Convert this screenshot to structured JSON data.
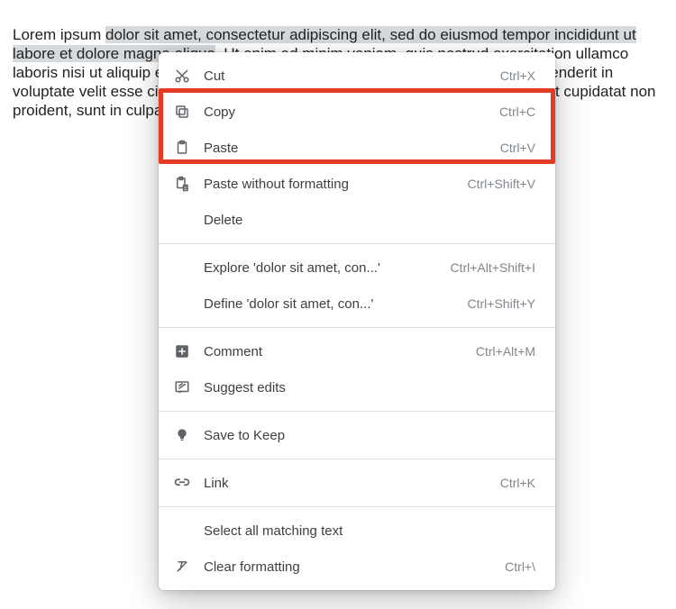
{
  "paragraph": {
    "before_sel": "Lorem ipsum ",
    "selection": "dolor sit amet, consectetur adipiscing elit, sed do eiusmod tempor incididunt ut labore et dolore magna aliqua",
    "after_sel": ". Ut enim ad minim veniam, quis nostrud exercitation ullamco laboris nisi ut aliquip ex ea commodo consequat. Duis aute irure dolor in reprehenderit in voluptate velit esse cillum dolore eu fugiat nulla pariatur. Excepteur sint occaecat cupidatat non proident, sunt in culpa qui officia."
  },
  "menu": {
    "cut": {
      "label": "Cut",
      "shortcut": "Ctrl+X"
    },
    "copy": {
      "label": "Copy",
      "shortcut": "Ctrl+C"
    },
    "paste": {
      "label": "Paste",
      "shortcut": "Ctrl+V"
    },
    "paste_plain": {
      "label": "Paste without formatting",
      "shortcut": "Ctrl+Shift+V"
    },
    "delete": {
      "label": "Delete",
      "shortcut": ""
    },
    "explore": {
      "label": "Explore 'dolor sit amet, con...'",
      "shortcut": "Ctrl+Alt+Shift+I"
    },
    "define": {
      "label": "Define 'dolor sit amet, con...'",
      "shortcut": "Ctrl+Shift+Y"
    },
    "comment": {
      "label": "Comment",
      "shortcut": "Ctrl+Alt+M"
    },
    "suggest": {
      "label": "Suggest edits",
      "shortcut": ""
    },
    "savekeep": {
      "label": "Save to Keep",
      "shortcut": ""
    },
    "link": {
      "label": "Link",
      "shortcut": "Ctrl+K"
    },
    "selectmatch": {
      "label": "Select all matching text",
      "shortcut": ""
    },
    "clearfmt": {
      "label": "Clear formatting",
      "shortcut": "Ctrl+\\"
    }
  }
}
